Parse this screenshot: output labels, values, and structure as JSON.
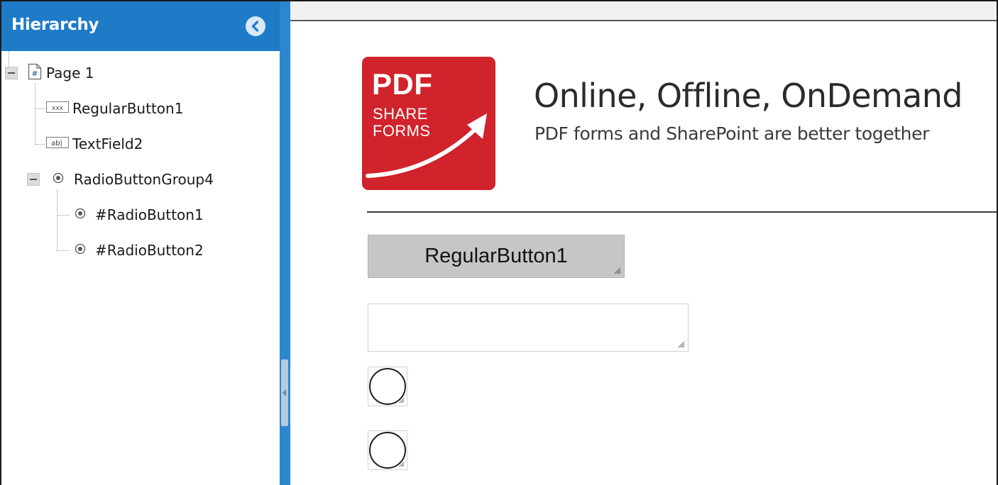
{
  "hierarchy": {
    "title": "Hierarchy",
    "collapse_icon": "chevron-left-circle-icon",
    "nodes": [
      {
        "label": "Page 1",
        "icon": "page-icon"
      },
      {
        "label": "RegularButton1",
        "icon": "button-icon",
        "icon_text": "xxx"
      },
      {
        "label": "TextField2",
        "icon": "textfield-icon",
        "icon_text": "ab|"
      },
      {
        "label": "RadioButtonGroup4",
        "icon": "radio-icon"
      },
      {
        "label": "#RadioButton1",
        "icon": "radio-icon"
      },
      {
        "label": "#RadioButton2",
        "icon": "radio-icon"
      }
    ]
  },
  "form": {
    "logo": {
      "line1": "PDF",
      "line2": "SHARE",
      "line3": "FORMS",
      "color": "#d0232b"
    },
    "tagline": "Online, Offline, OnDemand",
    "subtagline": "PDF forms and SharePoint are better together",
    "regular_button": "RegularButton1",
    "text_field_value": ""
  },
  "colors": {
    "header": "#1e7bc8",
    "splitter": "#2d86d0",
    "button_bg": "#c6c6c6"
  }
}
